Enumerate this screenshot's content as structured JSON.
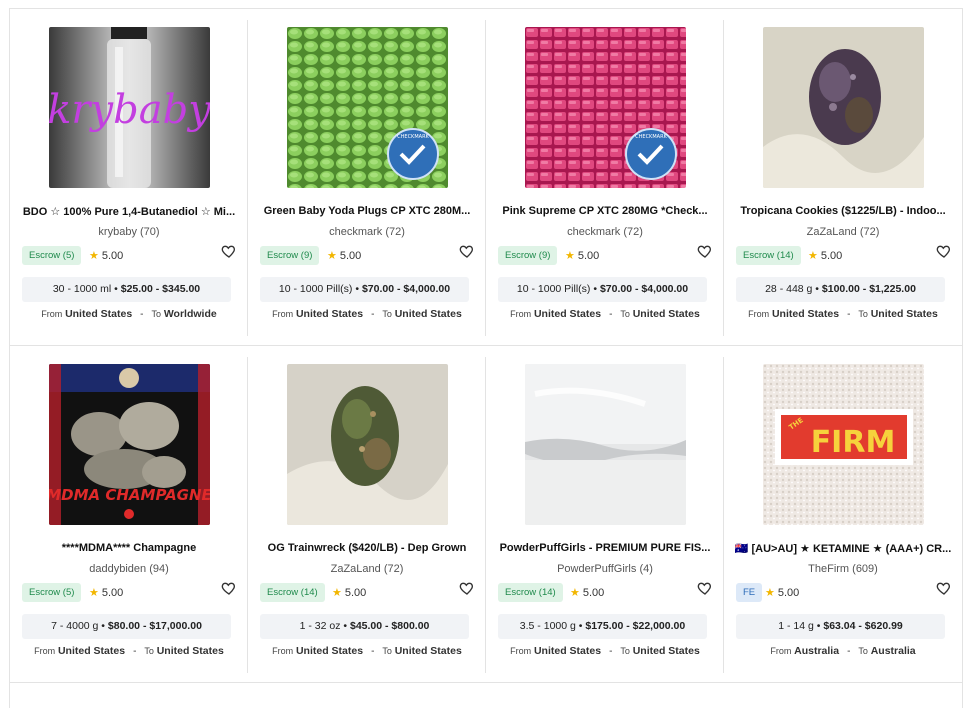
{
  "listings": [
    {
      "title": "BDO ☆ 100% Pure 1,4-Butanediol ☆ Mi...",
      "vendor": "krybaby",
      "vendor_count": "(70)",
      "badge": "Escrow (5)",
      "badge_type": "escrow",
      "rating": "5.00",
      "qty": "30 - 1000 ml",
      "price": "$25.00 - $345.00",
      "from_label": "From",
      "from": "United States",
      "to_label": "To",
      "to": "Worldwide",
      "image": "clear-bottle-krybaby-logo",
      "image_text": "krybaby"
    },
    {
      "title": "Green Baby Yoda Plugs CP XTC 280M...",
      "vendor": "checkmark",
      "vendor_count": "(72)",
      "badge": "Escrow (9)",
      "badge_type": "escrow",
      "rating": "5.00",
      "qty": "10 - 1000 Pill(s)",
      "price": "$70.00 - $4,000.00",
      "from_label": "From",
      "from": "United States",
      "to_label": "To",
      "to": "United States",
      "image": "green-pills-checkmark-seal",
      "image_text": "CHECKMARK"
    },
    {
      "title": "Pink Supreme CP XTC 280MG *Check...",
      "vendor": "checkmark",
      "vendor_count": "(72)",
      "badge": "Escrow (9)",
      "badge_type": "escrow",
      "rating": "5.00",
      "qty": "10 - 1000 Pill(s)",
      "price": "$70.00 - $4,000.00",
      "from_label": "From",
      "from": "United States",
      "to_label": "To",
      "to": "United States",
      "image": "pink-pills-checkmark-seal",
      "image_text": "CHECKMARK"
    },
    {
      "title": "Tropicana Cookies ($1225/LB) - Indoo...",
      "vendor": "ZaZaLand",
      "vendor_count": "(72)",
      "badge": "Escrow (14)",
      "badge_type": "escrow",
      "rating": "5.00",
      "qty": "28 - 448 g",
      "price": "$100.00 - $1,225.00",
      "from_label": "From",
      "from": "United States",
      "to_label": "To",
      "to": "United States",
      "image": "purple-bud-in-gloved-hand",
      "image_text": ""
    },
    {
      "title": "****MDMA**** Champagne",
      "vendor": "daddybiden",
      "vendor_count": "(94)",
      "badge": "Escrow (5)",
      "badge_type": "escrow",
      "rating": "5.00",
      "qty": "7 - 4000 g",
      "price": "$80.00 - $17,000.00",
      "from_label": "From",
      "from": "United States",
      "to_label": "To",
      "to": "United States",
      "image": "mdma-champagne-crystals-poster",
      "image_text": "MDMA CHAMPAGNE"
    },
    {
      "title": "OG Trainwreck ($420/LB) - Dep Grown",
      "vendor": "ZaZaLand",
      "vendor_count": "(72)",
      "badge": "Escrow (14)",
      "badge_type": "escrow",
      "rating": "5.00",
      "qty": "1 - 32 oz",
      "price": "$45.00 - $800.00",
      "from_label": "From",
      "from": "United States",
      "to_label": "To",
      "to": "United States",
      "image": "green-bud-in-gloved-hand",
      "image_text": ""
    },
    {
      "title": "PowderPuffGirls - PREMIUM PURE FIS...",
      "vendor": "PowderPuffGirls",
      "vendor_count": "(4)",
      "badge": "Escrow (14)",
      "badge_type": "escrow",
      "rating": "5.00",
      "qty": "3.5 - 1000 g",
      "price": "$175.00 - $22,000.00",
      "from_label": "From",
      "from": "United States",
      "to_label": "To",
      "to": "United States",
      "image": "white-powder-block",
      "image_text": ""
    },
    {
      "title": "🇦🇺 [AU>AU] ★ KETAMINE ★ (AAA+) CR...",
      "vendor": "TheFirm",
      "vendor_count": "(609)",
      "badge": "FE",
      "badge_type": "fe",
      "rating": "5.00",
      "qty": "1 - 14 g",
      "price": "$63.04 - $620.99",
      "from_label": "From",
      "from": "Australia",
      "to_label": "To",
      "to": "Australia",
      "image": "crystals-with-the-firm-sticker",
      "image_text": "THE FIRM"
    }
  ],
  "colors": {
    "escrow_bg": "#dff3e6",
    "escrow_text": "#1f8a4c",
    "fe_bg": "#dde9f8",
    "fe_text": "#2c6bb8",
    "star": "#f2b600",
    "price_bg": "#f1f3f6"
  }
}
